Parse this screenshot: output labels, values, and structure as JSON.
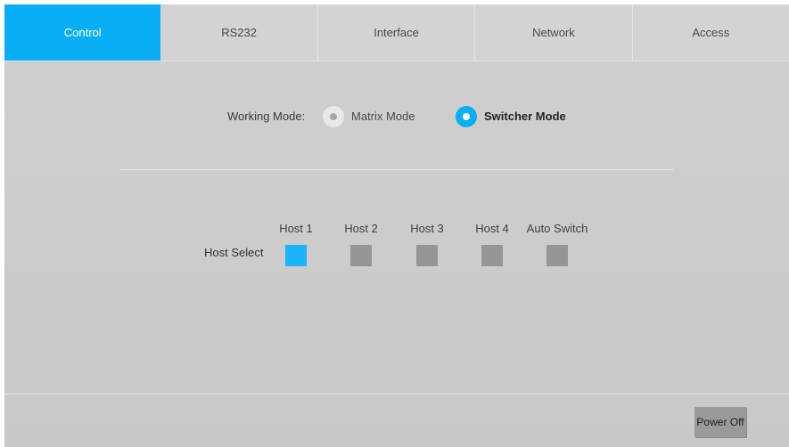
{
  "tabs": [
    {
      "label": "Control",
      "active": true
    },
    {
      "label": "RS232",
      "active": false
    },
    {
      "label": "Interface",
      "active": false
    },
    {
      "label": "Network",
      "active": false
    },
    {
      "label": "Access",
      "active": false
    }
  ],
  "working_mode": {
    "label": "Working Mode:",
    "options": [
      {
        "label": "Matrix Mode",
        "selected": false
      },
      {
        "label": "Switcher Mode",
        "selected": true
      }
    ]
  },
  "host_select": {
    "label": "Host Select",
    "hosts": [
      {
        "label": "Host 1",
        "selected": true
      },
      {
        "label": "Host 2",
        "selected": false
      },
      {
        "label": "Host 3",
        "selected": false
      },
      {
        "label": "Host 4",
        "selected": false
      },
      {
        "label": "Auto Switch",
        "selected": false
      }
    ]
  },
  "power_button": {
    "label": "Power Off"
  },
  "colors": {
    "accent": "#0aaef5",
    "inactive_box": "#959595",
    "background": "#cccccc"
  }
}
